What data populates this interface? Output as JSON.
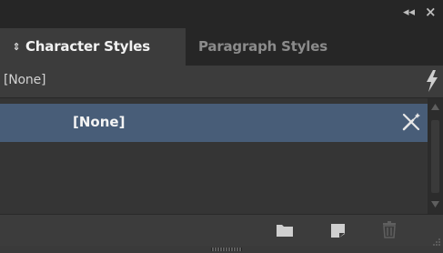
{
  "window": {
    "collapse_label": "◂◂",
    "close_label": "×"
  },
  "tabs": [
    {
      "label": "Character Styles",
      "active": true,
      "sort_glyph": "⇕"
    },
    {
      "label": "Paragraph Styles",
      "active": false
    }
  ],
  "panel_menu_icon": "panel-menu-icon",
  "current_style": {
    "label": "[None]",
    "action_icon": "lightning-bolt-icon"
  },
  "styles_list": [
    {
      "label": "[None]",
      "selected": true,
      "trailing_icon": "cannot-edit-icon"
    }
  ],
  "footer_buttons": [
    {
      "name": "new-style-group-button",
      "icon": "folder-icon"
    },
    {
      "name": "create-new-style-button",
      "icon": "new-page-icon"
    },
    {
      "name": "delete-style-button",
      "icon": "trash-icon",
      "disabled": true
    }
  ],
  "colors": {
    "panel_bg": "#323232",
    "tab_bar_bg": "#262626",
    "active_tab_bg": "#3c3c3c",
    "selection_bg": "#485d78",
    "text_primary": "#f2f2f2",
    "text_muted": "#8b8b8b"
  }
}
